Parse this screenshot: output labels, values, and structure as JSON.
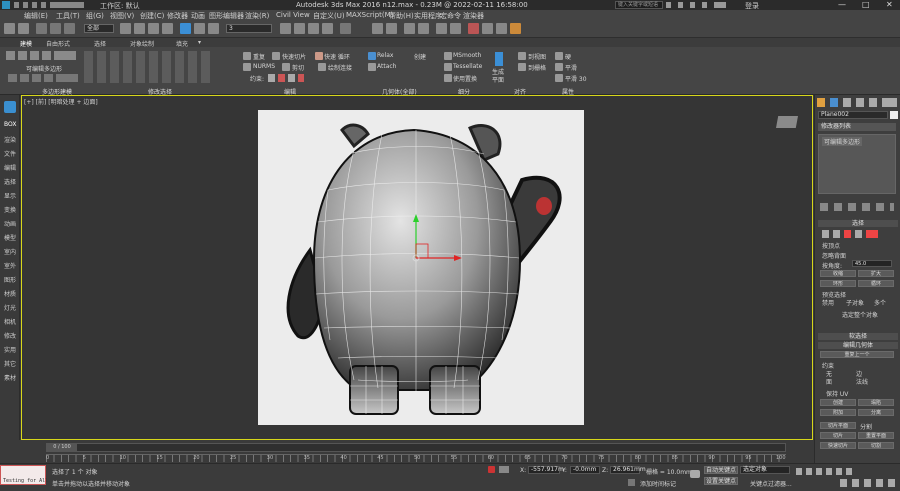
{
  "titlebar": {
    "title": "Autodesk 3ds Max 2016     n12.max - 0.23M @ 2022-02-11 16:58:00",
    "workspace": "工作区: 默认",
    "search_placeholder": "键入关键字或短语",
    "login": "登录"
  },
  "menubar": [
    "编辑(E)",
    "工具(T)",
    "组(G)",
    "视图(V)",
    "创建(C)",
    "修改器",
    "动画",
    "图形编辑器",
    "渲染(R)",
    "Civil View",
    "自定义(U)",
    "MAXScript(M)",
    "帮助(H)",
    "实用程序",
    "宏命令",
    "渲染器"
  ],
  "toolbar": {
    "filter": "全部",
    "snap": "3"
  },
  "ribbon": {
    "tabs": [
      "建模",
      "自由形式",
      "选择",
      "对象绘制",
      "填充",
      "▾"
    ],
    "left_label": "可编辑多边形",
    "items": {
      "repeat": "重复",
      "quickslice": "快速切片",
      "quickloop": "快速 循环",
      "nurms": "NURMS",
      "cut": "剪切",
      "paintconnect": "绘制连接",
      "constraint": "约束:",
      "relax": "Relax",
      "attach": "Attach",
      "create": "创建",
      "msmooth": "MSmooth",
      "tessellate": "Tessellate",
      "usedisplace": "使用置换",
      "generate_plane": "生成平面",
      "to_view": "到视图",
      "to_grid": "到栅格",
      "smooth": "平滑",
      "smooth2": "平滑",
      "smooth30": "平滑 30",
      "hard": "硬"
    },
    "groups": [
      "多边形建模",
      "修改选择",
      "编辑",
      "几何体(全部)",
      "细分",
      "对齐",
      "属性"
    ]
  },
  "leftbar": [
    "BOX",
    "渲染",
    "文件",
    "编辑",
    "选择",
    "显示",
    "变换",
    "动画",
    "模型",
    "室内",
    "室外",
    "图形",
    "材质",
    "灯光",
    "相机",
    "修改",
    "实用",
    "其它",
    "素材"
  ],
  "viewport": {
    "label": "[+] [前] [明暗处理 + 边面]"
  },
  "rightpanel": {
    "object_name": "Plane002",
    "modifier_list": "修改器列表",
    "stack_item": "可编辑多边形",
    "selection_header": "选择",
    "by_vertex": "按顶点",
    "ignore_back": "忽略背面",
    "by_angle": "按角度:",
    "angle_value": "45.0",
    "shrink": "收缩",
    "grow": "扩大",
    "ring": "环形",
    "loop": "循环",
    "preview_sel": "预览选择",
    "disabled": "禁用",
    "subobject": "子对象",
    "multi": "多个",
    "whole_selected": "选定整个对象",
    "soft_sel": "软选择",
    "edit_geom": "编辑几何体",
    "repeat_last": "重复上一个",
    "constraints": "约束",
    "none": "无",
    "edge": "边",
    "face": "面",
    "normal": "法线",
    "keep_uv": "保持 UV",
    "create": "创建",
    "collapse": "塌陷",
    "attach": "附加",
    "detach": "分离",
    "slice_plane": "切片平面",
    "split": "分割",
    "slice": "切片",
    "reset_plane": "重置平面",
    "quickslice": "快速切片",
    "cut": "切割"
  },
  "timeline": {
    "frame": "0 / 100",
    "ticks": [
      "0",
      "5",
      "10",
      "15",
      "20",
      "25",
      "30",
      "35",
      "40",
      "45",
      "50",
      "55",
      "60",
      "65",
      "70",
      "75",
      "80",
      "85",
      "90",
      "95",
      "100"
    ]
  },
  "status": {
    "listener": "Testing for All",
    "selected": "选择了 1 个 对象",
    "prompt": "单击并拖动以选择并移动对象",
    "x_label": "X:",
    "x_value": "-557.917m",
    "y_label": "Y:",
    "y_value": "-0.0mm",
    "z_label": "Z:",
    "z_value": "26.961mm",
    "grid": "栅格 = 10.0mm",
    "add_tag": "添加时间标记",
    "autokey": "自动关键点",
    "selected_obj": "选定对象",
    "setkey": "设置关键点",
    "key_filter": "关键点过滤器..."
  },
  "colors": {
    "accent_blue": "#3b8fd6",
    "viewport_border": "#d7d71a",
    "bg": "#3a3a3a"
  }
}
